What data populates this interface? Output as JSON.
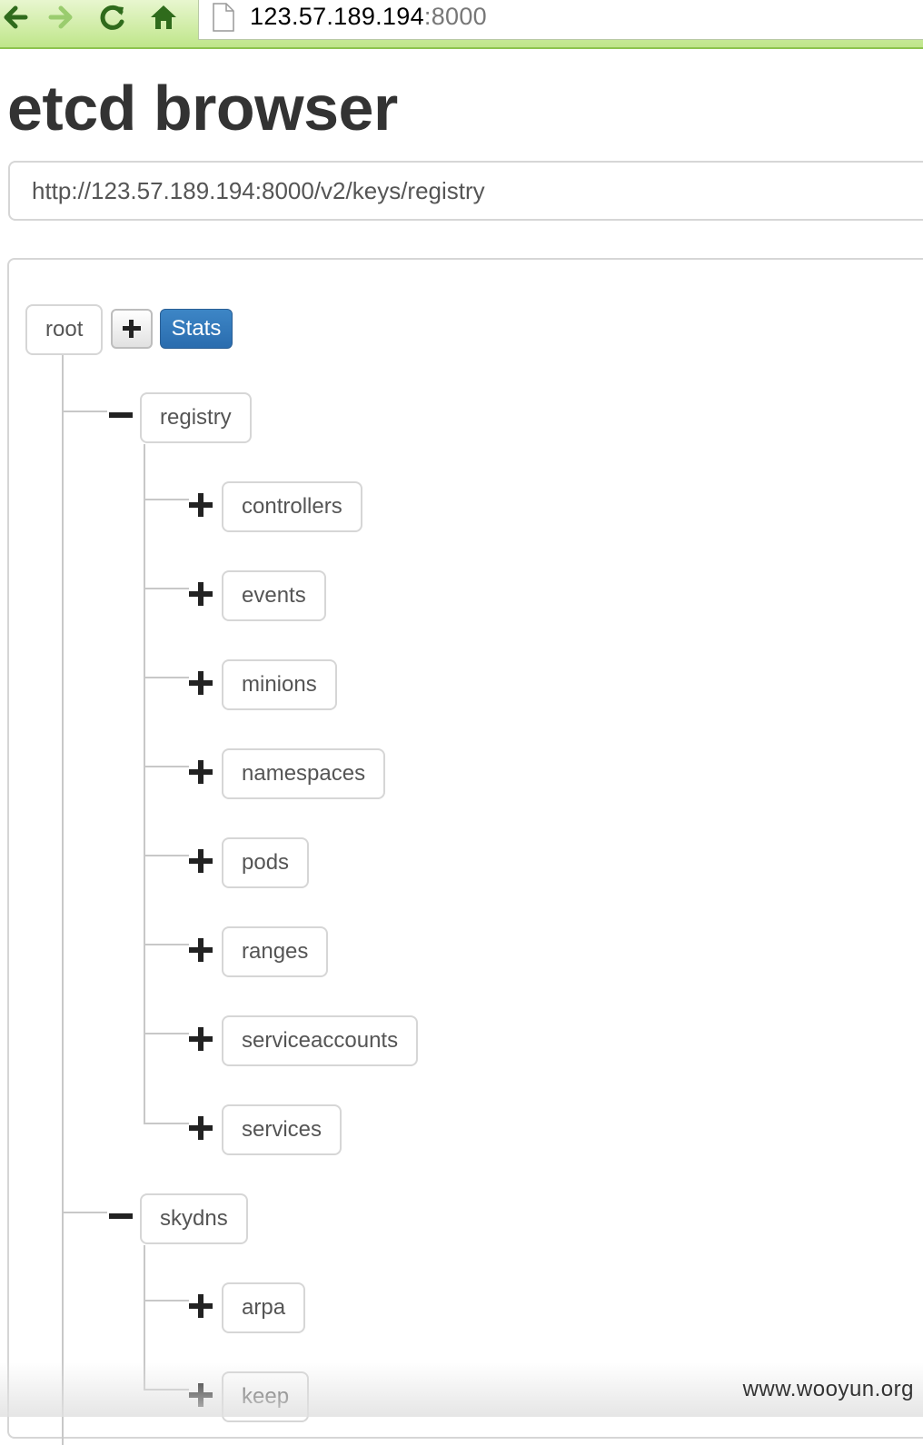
{
  "browser": {
    "address_host": "123.57.189.194",
    "address_port": ":8000"
  },
  "page": {
    "title": "etcd browser",
    "url_value": "http://123.57.189.194:8000/v2/keys/registry"
  },
  "toolbar": {
    "stats_label": "Stats"
  },
  "tree": {
    "root_label": "root",
    "groups": [
      {
        "label": "registry",
        "expanded": true,
        "children": [
          "controllers",
          "events",
          "minions",
          "namespaces",
          "pods",
          "ranges",
          "serviceaccounts",
          "services"
        ]
      },
      {
        "label": "skydns",
        "expanded": true,
        "children": [
          "arpa",
          "keep"
        ]
      }
    ]
  },
  "watermark": "www.wooyun.org",
  "colors": {
    "chrome_green": "#bfe68a",
    "stats_blue": "#2a6cae",
    "border_gray": "#d6d6d6"
  },
  "icons": [
    "back-arrow-icon",
    "forward-arrow-icon",
    "reload-icon",
    "home-icon",
    "page-icon",
    "plus-icon",
    "minus-icon"
  ]
}
